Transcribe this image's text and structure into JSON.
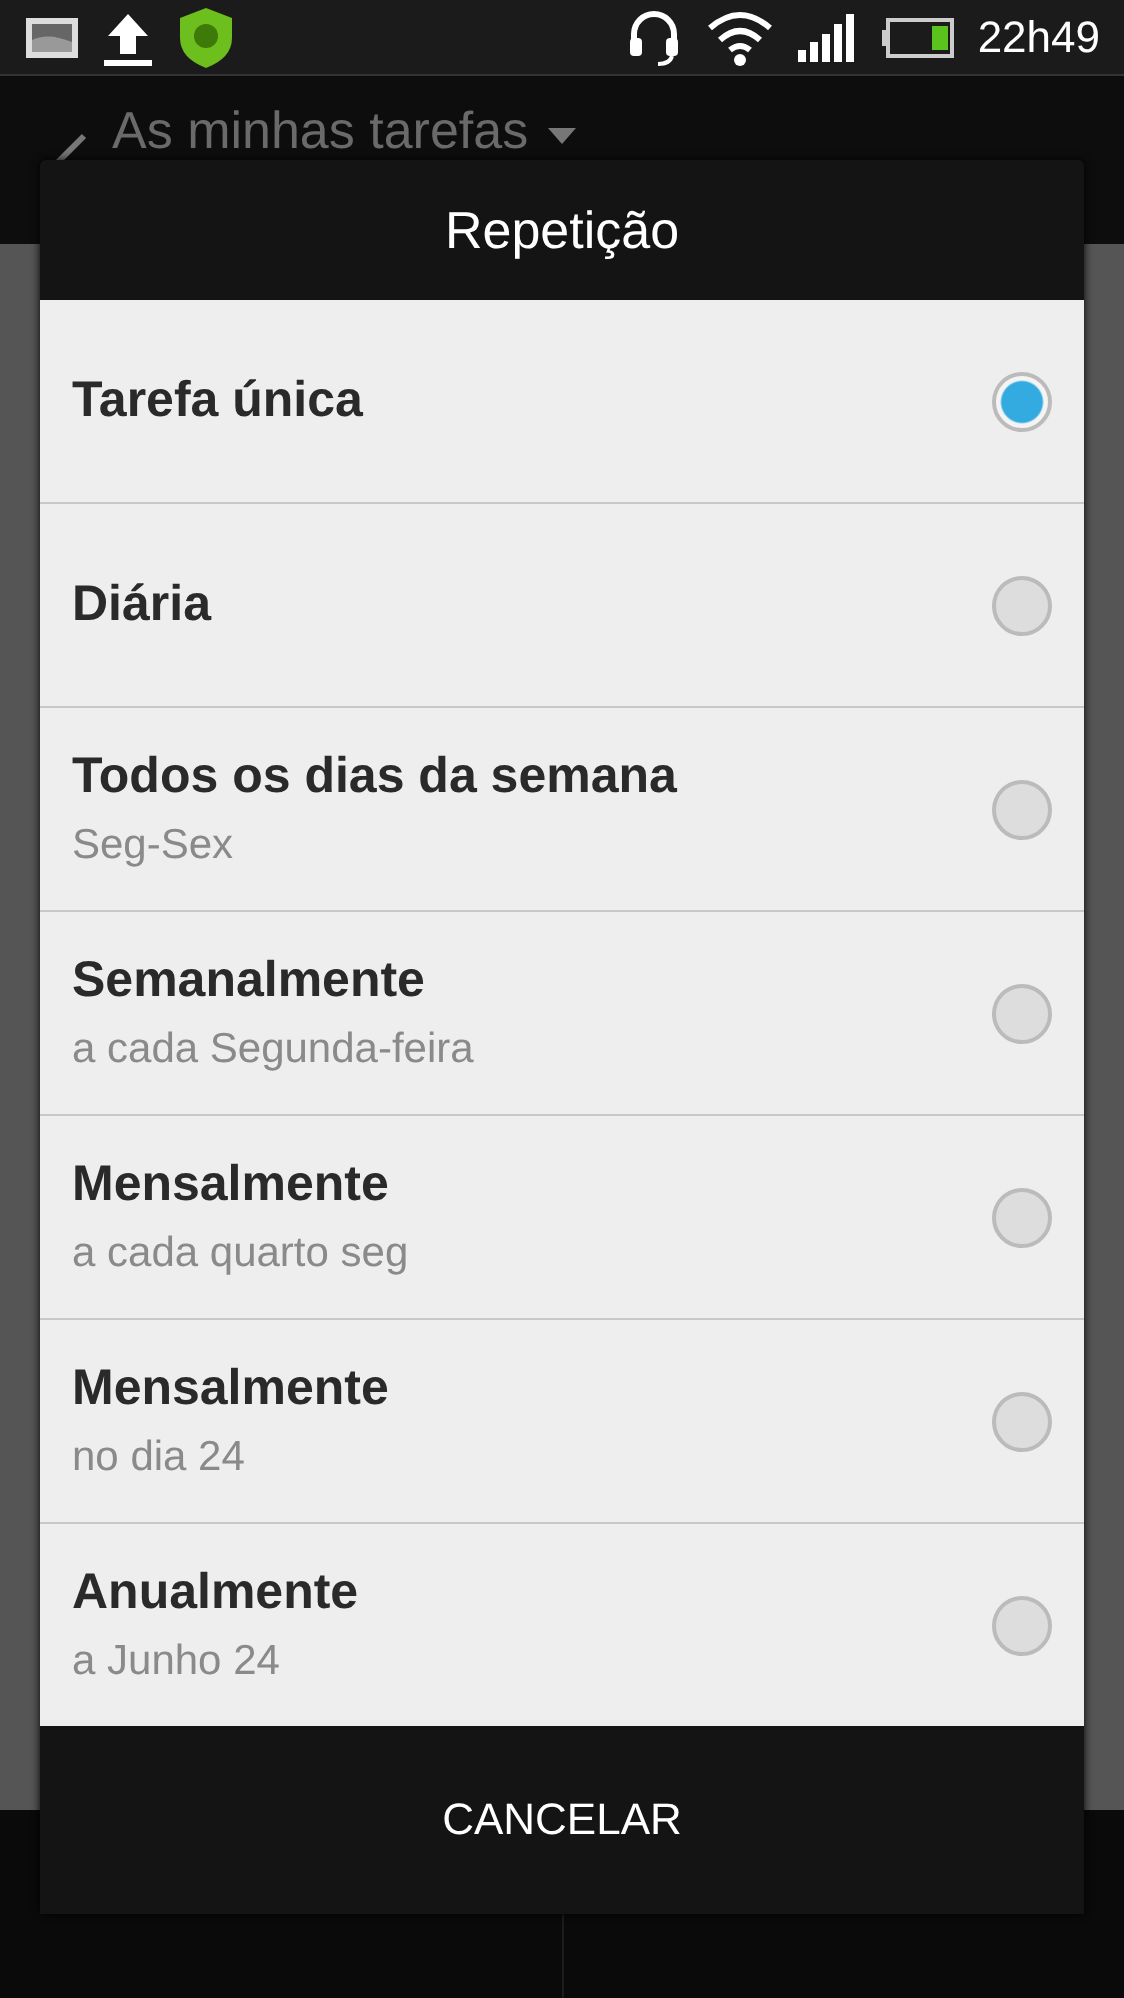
{
  "status_bar": {
    "time": "22h49"
  },
  "app_bar": {
    "title": "As minhas tarefas"
  },
  "dialog": {
    "title": "Repetição",
    "options": [
      {
        "label": "Tarefa única",
        "selected": true
      },
      {
        "label": "Diária",
        "selected": false
      },
      {
        "label": "Todos os dias da semana",
        "detail": "Seg-Sex",
        "selected": false
      },
      {
        "label": "Semanalmente",
        "detail": "a cada Segunda-feira",
        "selected": false
      },
      {
        "label": "Mensalmente",
        "detail": "a cada quarto seg",
        "selected": false
      },
      {
        "label": "Mensalmente",
        "detail": "no dia 24",
        "selected": false
      },
      {
        "label": "Anualmente",
        "detail": "a Junho 24",
        "selected": false
      }
    ],
    "button": "CANCELAR"
  }
}
